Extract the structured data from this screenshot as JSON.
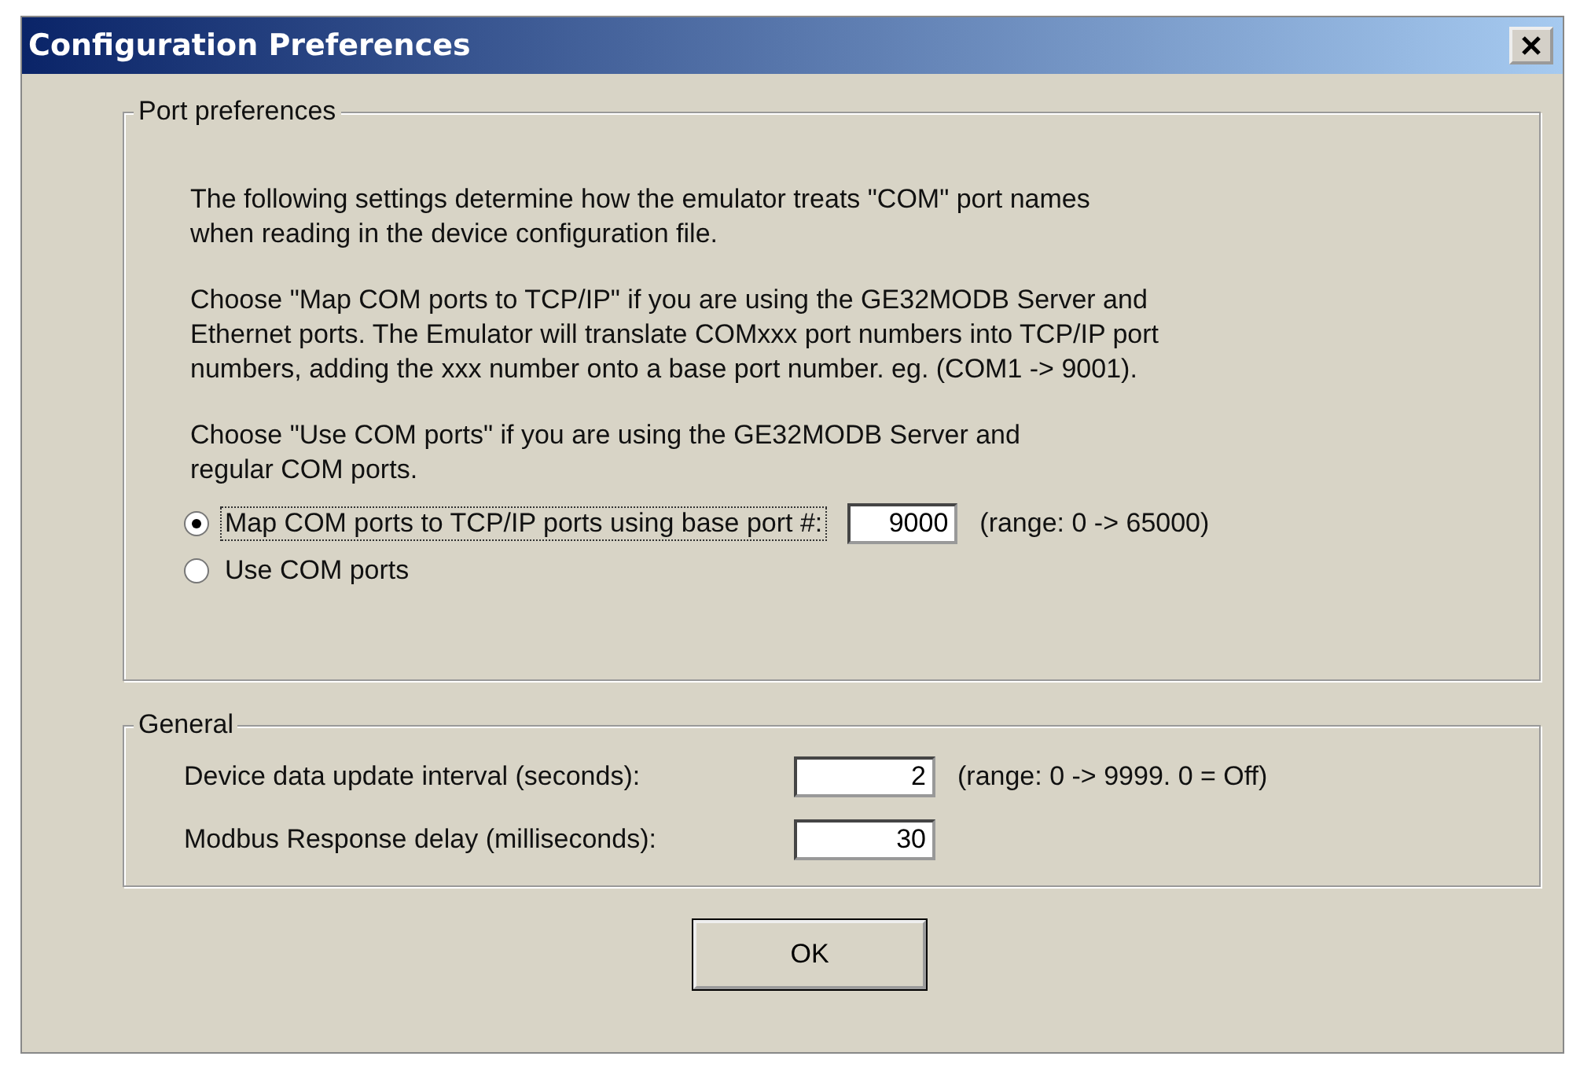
{
  "window": {
    "title": "Configuration Preferences"
  },
  "port_preferences": {
    "title": "Port preferences",
    "paragraphs": [
      "The following settings determine how the emulator treats \"COM\" port names\nwhen reading in the device configuration file.",
      "Choose \"Map COM ports to TCP/IP\" if you are using the GE32MODB Server and\nEthernet ports. The Emulator will translate COMxxx port numbers into TCP/IP port\nnumbers, adding the xxx number onto a base port number. eg. (COM1 -> 9001).",
      "Choose \"Use COM ports\" if you are using the GE32MODB Server and\nregular COM ports."
    ],
    "options": [
      {
        "label": "Map COM ports to TCP/IP ports using base port #:",
        "selected": true,
        "value": "9000",
        "range": "(range: 0 -> 65000)"
      },
      {
        "label": "Use COM ports",
        "selected": false
      }
    ]
  },
  "general": {
    "title": "General",
    "rows": [
      {
        "label": "Device data update interval (seconds):",
        "value": "2",
        "range": "(range: 0 -> 9999. 0 = Off)"
      },
      {
        "label": "Modbus Response delay (milliseconds):",
        "value": "30"
      }
    ]
  },
  "buttons": [
    "OK"
  ]
}
